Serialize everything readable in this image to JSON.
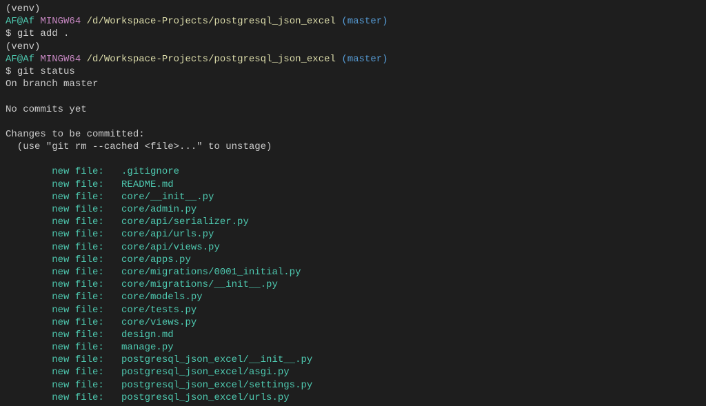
{
  "prompt1": {
    "venv": "(venv)",
    "userhost": "AF@Af",
    "shell": "MINGW64",
    "path": "/d/Workspace-Projects/postgresql_json_excel",
    "branch": "(master)",
    "cmd_prefix": "$ ",
    "cmd": "git add ."
  },
  "prompt2": {
    "venv": "(venv)",
    "userhost": "AF@Af",
    "shell": "MINGW64",
    "path": "/d/Workspace-Projects/postgresql_json_excel",
    "branch": "(master)",
    "cmd_prefix": "$ ",
    "cmd": "git status"
  },
  "status": {
    "on_branch": "On branch master",
    "no_commits": "No commits yet",
    "changes_header": "Changes to be committed:",
    "unstage_hint": "  (use \"git rm --cached <file>...\" to unstage)"
  },
  "files": [
    "        new file:   .gitignore",
    "        new file:   README.md",
    "        new file:   core/__init__.py",
    "        new file:   core/admin.py",
    "        new file:   core/api/serializer.py",
    "        new file:   core/api/urls.py",
    "        new file:   core/api/views.py",
    "        new file:   core/apps.py",
    "        new file:   core/migrations/0001_initial.py",
    "        new file:   core/migrations/__init__.py",
    "        new file:   core/models.py",
    "        new file:   core/tests.py",
    "        new file:   core/views.py",
    "        new file:   design.md",
    "        new file:   manage.py",
    "        new file:   postgresql_json_excel/__init__.py",
    "        new file:   postgresql_json_excel/asgi.py",
    "        new file:   postgresql_json_excel/settings.py",
    "        new file:   postgresql_json_excel/urls.py"
  ]
}
